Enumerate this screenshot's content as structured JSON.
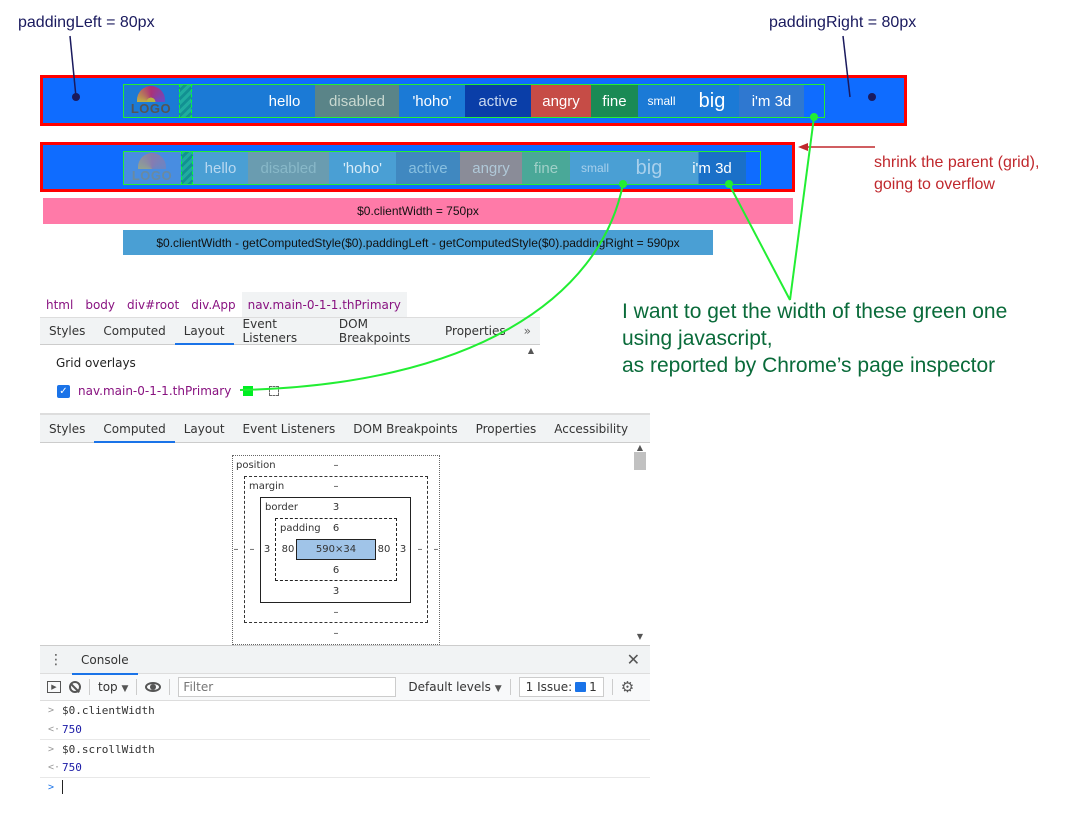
{
  "annotations": {
    "padding_left": "paddingLeft = 80px",
    "padding_right": "paddingRight = 80px",
    "shrink_note_line1": "shrink the parent (grid),",
    "shrink_note_line2": "going to overflow",
    "question_line1": "I want to get the width of these green one",
    "question_line2": "using javascript,",
    "question_line3": "as reported by Chrome’s page inspector",
    "client_width_bar": "$0.clientWidth = 750px",
    "content_width_bar": "$0.clientWidth - getComputedStyle($0).paddingLeft - getComputedStyle($0).paddingRight = 590px"
  },
  "nav": {
    "logo_text": "LOGO",
    "items": [
      {
        "label": "hello",
        "bg": "#0f6cff"
      },
      {
        "label": "disabled",
        "bg": "#5f7a8c"
      },
      {
        "label": "'hoho'",
        "bg": "#0f6cff"
      },
      {
        "label": "active",
        "bg": "#0026c8"
      },
      {
        "label": "angry",
        "bg": "#dc3545"
      },
      {
        "label": "fine",
        "bg": "#198754"
      },
      {
        "label": "small",
        "bg": "#0f6cff"
      },
      {
        "label": "big",
        "bg": "#0f6cff"
      },
      {
        "label": "i'm 3d",
        "bg": "#3a86ff"
      }
    ]
  },
  "colors": {
    "nav_bg": "#0f6cff",
    "border_red": "#ff0000",
    "grid_green": "#22ee33",
    "accent_blue": "#1a73e8"
  },
  "devtools_top": {
    "breadcrumbs": [
      "html",
      "body",
      "div#root",
      "div.App",
      "nav.main-0-1-1.thPrimary"
    ],
    "tabs": [
      "Styles",
      "Computed",
      "Layout",
      "Event Listeners",
      "DOM Breakpoints",
      "Properties"
    ],
    "active_tab": "Layout",
    "more_icon": "»",
    "section_title": "Grid overlays",
    "overlay_item": "nav.main-0-1-1.thPrimary",
    "overlay_checked": true,
    "overlay_color": "#00ee22"
  },
  "devtools_computed": {
    "tabs": [
      "Styles",
      "Computed",
      "Layout",
      "Event Listeners",
      "DOM Breakpoints",
      "Properties",
      "Accessibility"
    ],
    "active_tab": "Computed",
    "box_model": {
      "position_label": "position",
      "margin_label": "margin",
      "border_label": "border",
      "padding_label": "padding",
      "position": {
        "top": "–",
        "bottom": "–",
        "left": "–",
        "right": "–"
      },
      "margin": {
        "top": "–",
        "bottom": "–",
        "left": "–",
        "right": "–"
      },
      "border": {
        "top": "3",
        "bottom": "3",
        "left": "3",
        "right": "3"
      },
      "padding": {
        "top": "6",
        "bottom": "6",
        "left": "80",
        "right": "80"
      },
      "content": "590×34"
    }
  },
  "console": {
    "tab_label": "Console",
    "context": "top",
    "filter_placeholder": "Filter",
    "levels": "Default levels",
    "issues_label": "1 Issue:",
    "issues_count": "1",
    "entries": [
      {
        "input": "$0.clientWidth",
        "output": "750"
      },
      {
        "input": "$0.scrollWidth",
        "output": "750"
      }
    ]
  }
}
